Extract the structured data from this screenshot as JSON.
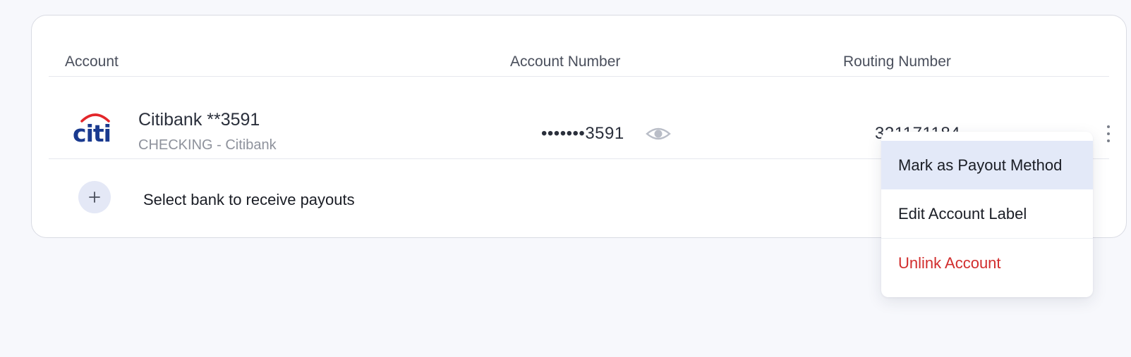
{
  "table": {
    "headers": {
      "account": "Account",
      "account_number": "Account Number",
      "routing_number": "Routing Number"
    },
    "row": {
      "logo_text": "citi",
      "bank_name": "Citibank **3591",
      "bank_sub": "CHECKING - Citibank",
      "account_number_masked": "•••••••3591",
      "routing_number": "321171184"
    },
    "add_bank_label": "Select bank to receive payouts"
  },
  "menu": {
    "items": [
      {
        "label": "Mark as Payout Method"
      },
      {
        "label": "Edit Account Label"
      },
      {
        "label": "Unlink Account"
      }
    ]
  },
  "colors": {
    "page_bg": "#f7f8fc",
    "card_bg": "#ffffff",
    "citi_blue": "#1a3a8f",
    "citi_red": "#e3262a",
    "menu_highlight": "#e3e9f8",
    "danger": "#d12d2d"
  },
  "icons": {
    "eye": "eye-icon",
    "kebab": "more-vertical-icon",
    "plus": "plus-icon"
  }
}
